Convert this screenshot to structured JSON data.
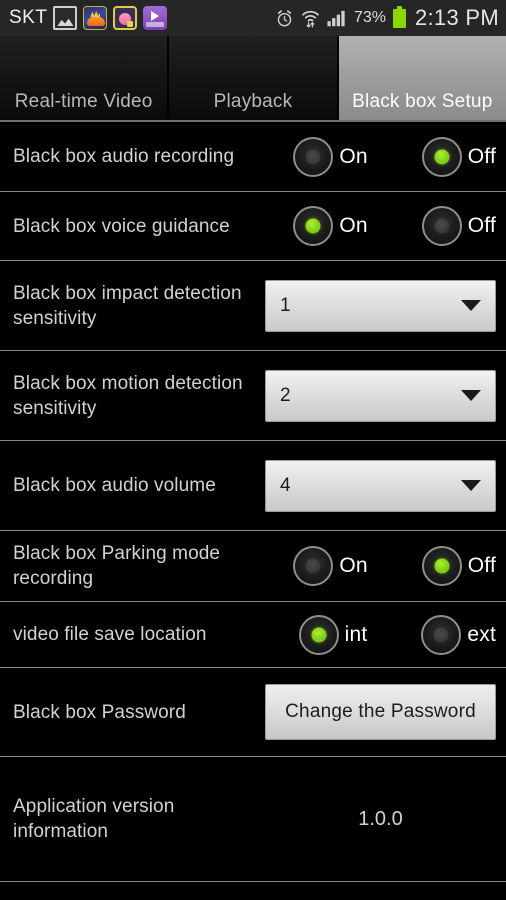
{
  "statusbar": {
    "carrier": "SKT",
    "app_icons": [
      "gallery-icon",
      "car-game-icon",
      "pink-character-icon",
      "video-player-icon"
    ],
    "alarm_icon": "alarm-clock-icon",
    "wifi_icon": "wifi-transfer-icon",
    "signal_icon": "cellular-signal-icon",
    "battery_percent": "73%",
    "battery_icon": "battery-icon",
    "time": "2:13 PM"
  },
  "tabs": [
    {
      "label": "Real-time Video",
      "selected": false
    },
    {
      "label": "Playback",
      "selected": false
    },
    {
      "label": "Black box Setup",
      "selected": true
    }
  ],
  "rows": [
    {
      "id": "audio-recording",
      "label": "Black box audio recording",
      "type": "radio",
      "options": [
        {
          "text": "On",
          "selected": false
        },
        {
          "text": "Off",
          "selected": true
        }
      ]
    },
    {
      "id": "voice-guidance",
      "label": "Black box voice guidance",
      "type": "radio",
      "options": [
        {
          "text": "On",
          "selected": true
        },
        {
          "text": "Off",
          "selected": false
        }
      ]
    },
    {
      "id": "impact-detection-sensitivity",
      "label": "Black box impact detection sensitivity",
      "type": "dropdown",
      "value": "1"
    },
    {
      "id": "motion-detection-sensitivity",
      "label": "Black box motion detection sensitivity",
      "type": "dropdown",
      "value": "2"
    },
    {
      "id": "audio-volume",
      "label": "Black box audio volume",
      "type": "dropdown",
      "value": "4"
    },
    {
      "id": "parking-mode-recording",
      "label": "Black box Parking mode recording",
      "type": "radio",
      "options": [
        {
          "text": "On",
          "selected": false
        },
        {
          "text": "Off",
          "selected": true
        }
      ]
    },
    {
      "id": "video-file-save-location",
      "label": "video file save location",
      "type": "radio",
      "options": [
        {
          "text": "int",
          "selected": true
        },
        {
          "text": "ext",
          "selected": false
        }
      ]
    },
    {
      "id": "password",
      "label": "Black box Password",
      "type": "button",
      "button_label": "Change the Password"
    },
    {
      "id": "app-version",
      "label": "Application version information",
      "type": "value",
      "value": "1.0.0"
    }
  ],
  "colors": {
    "accent_green": "#8cd619",
    "background": "#000000",
    "separator": "#8a8a8a",
    "label_text": "#d2d2d2",
    "statusbar_bg": "#262626",
    "selected_tab": "#9d9d9d"
  }
}
